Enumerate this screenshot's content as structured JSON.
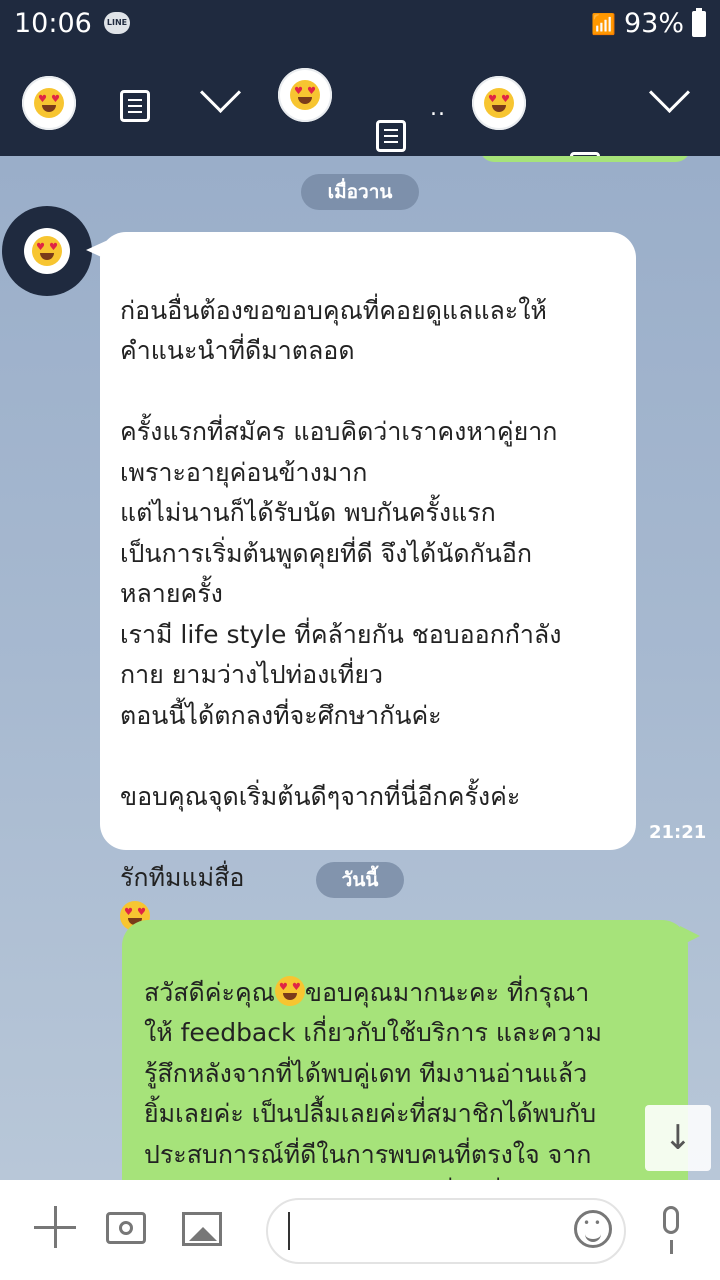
{
  "status_bar": {
    "time": "10:06",
    "notification_app": "LINE",
    "battery": "93%"
  },
  "header": {
    "participants": [
      "avatar-1",
      "avatar-2",
      "avatar-3"
    ],
    "more": ".."
  },
  "chat": {
    "dates": [
      "เมื่อวาน",
      "วันนี้"
    ],
    "incoming": {
      "text": "ก่อนอื่นต้องขอขอบคุณที่คอยดูแลและให้\nคำแนะนำที่ดีมาตลอด\n\nครั้งแรกที่สมัคร แอบคิดว่าเราคงหาคู่ยาก\nเพราะอายุค่อนข้างมาก\nแต่ไม่นานก็ได้รับนัด พบกันครั้งแรก\nเป็นการเริ่มต้นพูดคุยที่ดี จึงได้นัดกันอีก\nหลายครั้ง\nเรามี life style ที่คล้ายกัน ชอบออกกำลัง\nกาย ยามว่างไปท่องเที่ยว\nตอนนี้ได้ตกลงที่จะศึกษากันค่ะ\n\nขอบคุณจุดเริ่มต้นดีๆจากที่นี่อีกครั้งค่ะ\n\nรักทีมแม่สื่อ",
      "time": "21:21"
    },
    "outgoing": {
      "text_before_emoji": "สวัสดีค่ะคุณ",
      "text_after_emoji": "ขอบคุณมากนะคะ ที่กรุณา\nให้ feedback เกี่ยวกับใช้บริการ และความ\nรู้สึกหลังจากที่ได้พบคู่เดท ทีมงานอ่านแล้ว\nยิ้มเลยค่ะ เป็นปลื้มเลยค่ะที่สมาชิกได้พบกับ\nประสบการณ์ที่ดีในการพบคนที่ตรงใจ จาก\nการทำงานของทีมงาน ยินดีที่สุดที่ได้มีส่วน"
    }
  },
  "input_bar": {
    "placeholder": ""
  },
  "colors": {
    "header_bg": "#1f2a3f",
    "out_bubble": "#a6e37a",
    "in_bubble": "#ffffff"
  }
}
